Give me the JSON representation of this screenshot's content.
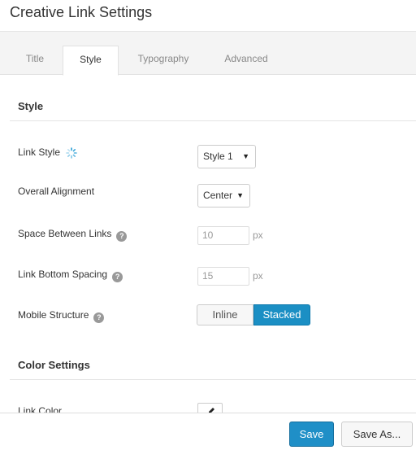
{
  "window": {
    "title": "Creative Link Settings"
  },
  "tabs": [
    {
      "label": "Title",
      "active": false
    },
    {
      "label": "Style",
      "active": true
    },
    {
      "label": "Typography",
      "active": false
    },
    {
      "label": "Advanced",
      "active": false
    }
  ],
  "style_section": {
    "heading": "Style",
    "link_style": {
      "label": "Link Style",
      "value": "Style 1"
    },
    "overall_alignment": {
      "label": "Overall Alignment",
      "value": "Center"
    },
    "space_between_links": {
      "label": "Space Between Links",
      "placeholder": "10",
      "unit": "px"
    },
    "link_bottom_spacing": {
      "label": "Link Bottom Spacing",
      "placeholder": "15",
      "unit": "px"
    },
    "mobile_structure": {
      "label": "Mobile Structure",
      "options": [
        "Inline",
        "Stacked"
      ],
      "selected": "Stacked"
    }
  },
  "color_section": {
    "heading": "Color Settings",
    "link_color": {
      "label": "Link Color"
    }
  },
  "footer": {
    "save_label": "Save",
    "save_as_label": "Save As..."
  },
  "colors": {
    "accent": "#1f8fc7",
    "help_icon": "#999999"
  }
}
